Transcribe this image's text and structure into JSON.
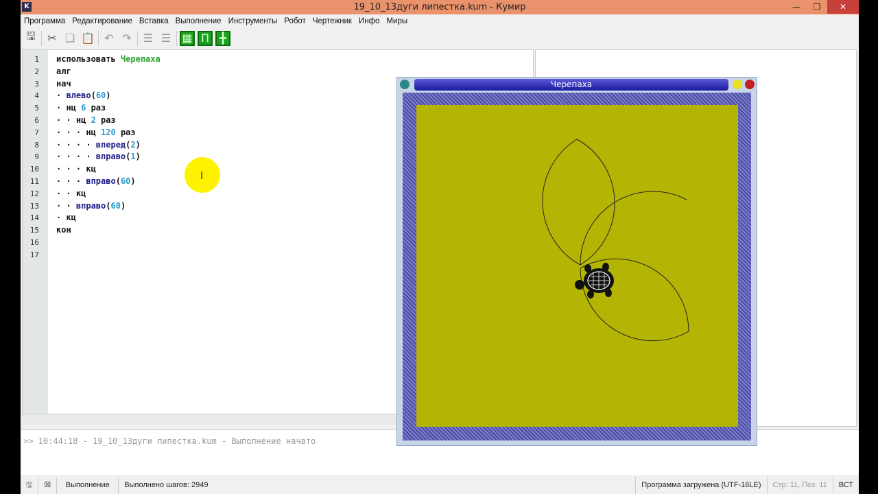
{
  "window": {
    "title": "19_10_13дуги липестка.kum - Кумир",
    "logo": "K"
  },
  "menu": [
    "Программа",
    "Редактирование",
    "Вставка",
    "Выполнение",
    "Инструменты",
    "Робот",
    "Чертежник",
    "Инфо",
    "Миры"
  ],
  "editor": {
    "lines": [
      {
        "n": "1",
        "parts": [
          [
            "kw",
            "использовать "
          ],
          [
            "mod",
            "Черепаха"
          ]
        ]
      },
      {
        "n": "2",
        "parts": [
          [
            "kw",
            "алг"
          ]
        ]
      },
      {
        "n": "3",
        "parts": [
          [
            "kw",
            "нач"
          ]
        ]
      },
      {
        "n": "4",
        "parts": [
          [
            "kw",
            "· "
          ],
          [
            "fn",
            "влево"
          ],
          [
            "kw",
            "("
          ],
          [
            "num",
            "60"
          ],
          [
            "kw",
            ")"
          ]
        ]
      },
      {
        "n": "5",
        "parts": [
          [
            "kw",
            "· нц "
          ],
          [
            "num",
            "6"
          ],
          [
            "kw",
            " раз"
          ]
        ]
      },
      {
        "n": "6",
        "parts": [
          [
            "kw",
            "· · нц "
          ],
          [
            "num",
            "2"
          ],
          [
            "kw",
            " раз"
          ]
        ]
      },
      {
        "n": "7",
        "parts": [
          [
            "kw",
            "· · · нц "
          ],
          [
            "num",
            "120"
          ],
          [
            "kw",
            " раз"
          ]
        ]
      },
      {
        "n": "8",
        "parts": [
          [
            "kw",
            "· · · · "
          ],
          [
            "fn",
            "вперед"
          ],
          [
            "kw",
            "("
          ],
          [
            "num",
            "2"
          ],
          [
            "kw",
            ")"
          ]
        ]
      },
      {
        "n": "9",
        "parts": [
          [
            "kw",
            "· · · · "
          ],
          [
            "fn",
            "вправо"
          ],
          [
            "kw",
            "("
          ],
          [
            "num",
            "1"
          ],
          [
            "kw",
            ")"
          ]
        ]
      },
      {
        "n": "10",
        "parts": [
          [
            "kw",
            "· · · кц"
          ]
        ]
      },
      {
        "n": "11",
        "parts": [
          [
            "kw",
            "· · · "
          ],
          [
            "fn",
            "вправо"
          ],
          [
            "kw",
            "("
          ],
          [
            "num",
            "60"
          ],
          [
            "kw",
            ")"
          ]
        ]
      },
      {
        "n": "12",
        "parts": [
          [
            "kw",
            "· · кц"
          ]
        ]
      },
      {
        "n": "13",
        "parts": [
          [
            "kw",
            "· · "
          ],
          [
            "fn",
            "вправо"
          ],
          [
            "kw",
            "("
          ],
          [
            "num",
            "60"
          ],
          [
            "kw",
            ")"
          ]
        ]
      },
      {
        "n": "14",
        "parts": [
          [
            "kw",
            "· кц"
          ]
        ]
      },
      {
        "n": "15",
        "parts": [
          [
            "kw",
            "кон"
          ]
        ]
      },
      {
        "n": "16",
        "parts": []
      },
      {
        "n": "17",
        "parts": []
      }
    ]
  },
  "turtle_window": {
    "title": "Черепаха",
    "canvas_color": "#b4b404"
  },
  "console": {
    "text": ">> 10:44:18 - 19_10_13дуги липестка.kum - Выполнение начато"
  },
  "status": {
    "mode": "Выполнение",
    "steps": "Выполнено шагов: 2949",
    "loaded": "Программа загружена (UTF-16LE)",
    "position": "Стр: 11, Поз: 11",
    "insert": "ВСТ"
  }
}
